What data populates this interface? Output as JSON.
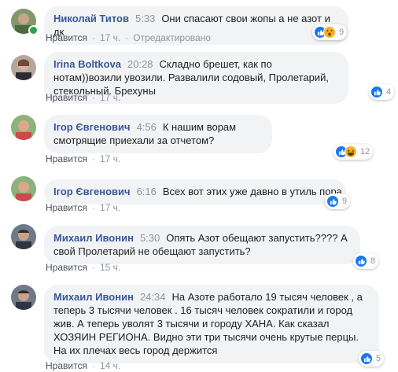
{
  "like_label": "Нравится",
  "separator": "·",
  "comments": [
    {
      "author": "Николай Титов",
      "time": "5:33",
      "text": "Они спасают свои жопы а не азот и дк",
      "age": "17 ч.",
      "edited": "Отредактировано",
      "reactions": [
        "like",
        "wow"
      ],
      "count": "9"
    },
    {
      "author": "Irina Boltkova",
      "time": "20:28",
      "text": "Складно брешет, как по нотам))возили увозили. Развалили содовый, Пролетарий, стекольный. Брехуны",
      "age": "17 ч.",
      "reactions": [
        "like"
      ],
      "count": "4"
    },
    {
      "author": "Ігор Євгенович",
      "time": "4:56",
      "text": "К нашим ворам смотрящие приехали за отчетом?",
      "age": "17 ч.",
      "reactions": [
        "like",
        "haha"
      ],
      "count": "12"
    },
    {
      "author": "Ігор Євгенович",
      "time": "6:16",
      "text": "Всех вот этих уже давно в утиль пора",
      "age": "17 ч.",
      "reactions": [
        "like"
      ],
      "count": "9"
    },
    {
      "author": "Михаил Ивонин",
      "time": "5:30",
      "text": "Опять Азот обещают запустить???? А свой Пролетарий не обещают запустить?",
      "age": "15 ч.",
      "reactions": [
        "like"
      ],
      "count": "8"
    },
    {
      "author": "Михаил Ивонин",
      "time": "24:34",
      "text": "На Азоте работало 19 тысяч человек , а теперь 3 тысячи человек . 16 тысяч человек сократили и город жив. А теперь уволят 3 тысячи и городу ХАНА. Как сказал ХОЗЯИН РЕГИОНА. Видно эти три тысячи очень крутые перцы. На их плечах весь город держится",
      "age": "14 ч.",
      "reactions": [
        "like"
      ],
      "count": "5"
    }
  ]
}
